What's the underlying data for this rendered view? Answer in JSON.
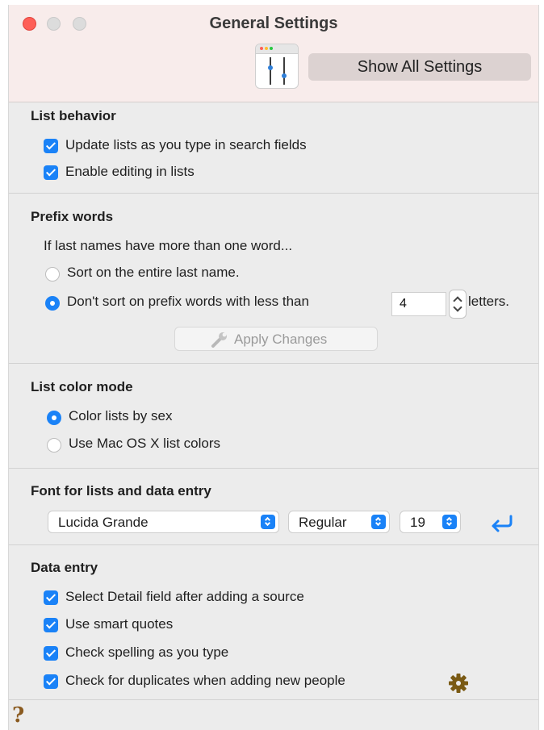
{
  "window": {
    "title": "General Settings",
    "show_all_label": "Show All Settings"
  },
  "list_behavior": {
    "heading": "List behavior",
    "options": [
      {
        "label": "Update lists as you type in search fields",
        "checked": true
      },
      {
        "label": "Enable editing in lists",
        "checked": true
      }
    ]
  },
  "prefix_words": {
    "heading": "Prefix words",
    "intro": "If last names have more than one word...",
    "option_entire": "Sort on the entire last name.",
    "option_prefix": "Don't sort on prefix words with less than",
    "letters_value": "4",
    "letters_suffix": "letters.",
    "selected": "prefix",
    "apply_label": "Apply Changes"
  },
  "list_color_mode": {
    "heading": "List color mode",
    "option_sex": "Color lists by sex",
    "option_mac": "Use Mac OS X list colors",
    "selected": "sex"
  },
  "font": {
    "heading": "Font for lists and data entry",
    "family": "Lucida Grande",
    "style": "Regular",
    "size": "19"
  },
  "data_entry": {
    "heading": "Data entry",
    "options": [
      {
        "label": "Select Detail field after adding a source",
        "checked": true
      },
      {
        "label": "Use smart quotes",
        "checked": true
      },
      {
        "label": "Check spelling as you type",
        "checked": true
      },
      {
        "label": "Check for duplicates when adding new people",
        "checked": true
      }
    ]
  },
  "footer": {
    "help_label": "?"
  },
  "colors": {
    "accent": "#1a82f7",
    "titlebar": "#f8eceb",
    "panel": "#ececec",
    "gear": "#7a5a14",
    "help": "#8a5a1f"
  }
}
